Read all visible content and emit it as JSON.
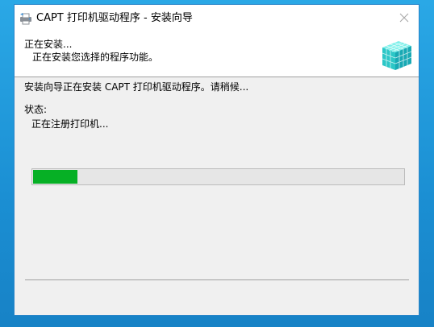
{
  "window": {
    "title": "CAPT 打印机驱动程序 - 安装向导",
    "app_icon": "printer-setup-icon",
    "close_icon": "close-icon"
  },
  "header": {
    "title": "正在安装...",
    "subtitle": "正在安装您选择的程序功能。",
    "graphic_icon": "install-cubes-graphic"
  },
  "body": {
    "install_message": "安装向导正在安装 CAPT 打印机驱动程序。请稍候...",
    "status_label": "状态:",
    "status_value": "正在注册打印机..."
  },
  "progress": {
    "value_percent": 12,
    "color": "#06b025"
  },
  "colors": {
    "desktop": "#1796d8",
    "window_bg": "#f0f0f0",
    "header_bg": "#ffffff",
    "progress_fill": "#06b025"
  }
}
